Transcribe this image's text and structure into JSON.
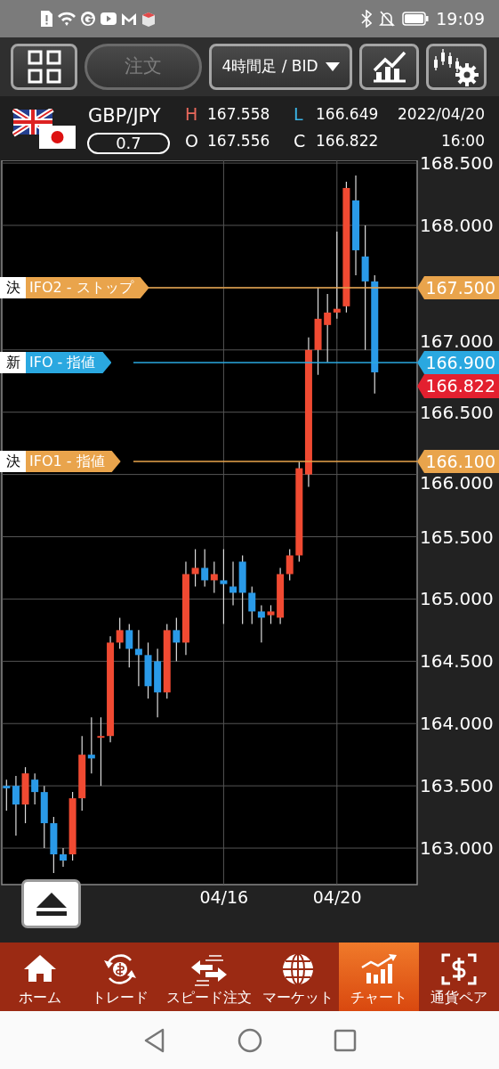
{
  "status_bar": {
    "time": "19:09"
  },
  "toolbar": {
    "order_button": {
      "label": "注文",
      "disabled": true
    },
    "timeframe": {
      "label": "4時間足 / BID"
    }
  },
  "quote": {
    "pair": "GBP/JPY",
    "spread": "0.7",
    "date": "2022/04/20",
    "time": "16:00",
    "fields": [
      {
        "letter": "H",
        "value": "167.558",
        "color": "#e8685c"
      },
      {
        "letter": "L",
        "value": "166.649",
        "color": "#3bb4e6"
      },
      {
        "letter": "O",
        "value": "167.556",
        "color": "#ffffff"
      },
      {
        "letter": "C",
        "value": "166.822",
        "color": "#ffffff"
      }
    ]
  },
  "chart": {
    "chart_data": {
      "type": "candlestick",
      "categories": [
        null,
        null,
        null,
        null,
        null,
        null,
        null,
        null,
        null,
        null,
        null,
        null,
        null,
        null,
        null,
        null,
        null,
        null,
        null,
        null,
        null,
        null,
        null,
        "04/16",
        null,
        null,
        null,
        null,
        null,
        null,
        null,
        null,
        null,
        null,
        null,
        "04/20",
        null,
        null,
        null,
        null,
        null,
        null,
        null,
        null
      ],
      "ohlc": [
        [
          163.5,
          163.55,
          163.3,
          163.48
        ],
        [
          163.5,
          163.58,
          163.1,
          163.35
        ],
        [
          163.35,
          163.65,
          163.2,
          163.6
        ],
        [
          163.55,
          163.6,
          163.35,
          163.45
        ],
        [
          163.45,
          163.5,
          163.0,
          163.2
        ],
        [
          163.2,
          163.25,
          162.8,
          162.95
        ],
        [
          162.95,
          163.0,
          162.85,
          162.9
        ],
        [
          162.95,
          163.45,
          162.9,
          163.4
        ],
        [
          163.4,
          163.9,
          163.3,
          163.75
        ],
        [
          163.75,
          164.05,
          163.6,
          163.72
        ],
        [
          163.9,
          164.05,
          163.5,
          163.9
        ],
        [
          163.9,
          164.7,
          163.85,
          164.65
        ],
        [
          164.65,
          164.85,
          164.6,
          164.75
        ],
        [
          164.75,
          164.8,
          164.45,
          164.6
        ],
        [
          164.6,
          164.75,
          164.3,
          164.55
        ],
        [
          164.55,
          164.65,
          164.2,
          164.3
        ],
        [
          164.5,
          164.6,
          164.05,
          164.25
        ],
        [
          164.25,
          164.8,
          164.2,
          164.75
        ],
        [
          164.75,
          164.85,
          164.5,
          164.65
        ],
        [
          164.65,
          165.3,
          164.55,
          165.2
        ],
        [
          165.2,
          165.4,
          165.1,
          165.25
        ],
        [
          165.25,
          165.4,
          165.1,
          165.15
        ],
        [
          165.15,
          165.3,
          165.05,
          165.2
        ],
        [
          165.15,
          165.4,
          164.8,
          165.12
        ],
        [
          165.1,
          165.3,
          164.95,
          165.05
        ],
        [
          165.3,
          165.35,
          164.8,
          165.05
        ],
        [
          165.05,
          165.1,
          164.8,
          164.9
        ],
        [
          164.9,
          164.95,
          164.65,
          164.85
        ],
        [
          164.87,
          164.95,
          164.8,
          164.9
        ],
        [
          164.85,
          165.25,
          164.8,
          165.2
        ],
        [
          165.2,
          165.4,
          165.15,
          165.35
        ],
        [
          165.35,
          166.1,
          165.3,
          166.05
        ],
        [
          166.0,
          167.1,
          165.9,
          167.0
        ],
        [
          167.0,
          167.5,
          166.8,
          167.25
        ],
        [
          167.2,
          167.45,
          166.9,
          167.3
        ],
        [
          167.3,
          167.95,
          167.25,
          167.33
        ],
        [
          167.35,
          168.35,
          167.3,
          168.3
        ],
        [
          168.2,
          168.4,
          167.6,
          167.8
        ],
        [
          167.75,
          168.0,
          167.0,
          167.55
        ],
        [
          167.55,
          167.6,
          166.65,
          166.82
        ],
        null,
        null,
        null,
        null
      ],
      "yticks": [
        {
          "value": 168.5,
          "label": "168.500"
        },
        {
          "value": 168,
          "label": "168.000"
        },
        {
          "value": 167,
          "label": "167.000"
        },
        {
          "value": 166.5,
          "label": "166.500"
        },
        {
          "value": 166,
          "label": "166.000"
        },
        {
          "value": 165.5,
          "label": "165.500"
        },
        {
          "value": 165,
          "label": "165.000"
        },
        {
          "value": 164.5,
          "label": "164.500"
        },
        {
          "value": 164,
          "label": "164.000"
        },
        {
          "value": 163.5,
          "label": "163.500"
        },
        {
          "value": 163,
          "label": "163.000"
        }
      ],
      "ylim": [
        162.707,
        168.522
      ],
      "grid": true
    },
    "order_lines": [
      {
        "tag": "決",
        "label": "IFO2 - ストップ",
        "price": "167.500",
        "kind": "settle"
      },
      {
        "tag": "新",
        "label": "IFO - 指値",
        "price": "166.900",
        "kind": "new"
      },
      {
        "tag": "決",
        "label": "IFO1 - 指値",
        "price": "166.100",
        "kind": "settle"
      }
    ],
    "current_price": "166.822"
  },
  "bottom_nav": [
    {
      "label": "ホーム",
      "selected": false
    },
    {
      "label": "トレード",
      "selected": false
    },
    {
      "label": "スピード注文",
      "selected": false
    },
    {
      "label": "マーケット",
      "selected": false
    },
    {
      "label": "チャート",
      "selected": true
    },
    {
      "label": "通貨ペア",
      "selected": false
    }
  ]
}
